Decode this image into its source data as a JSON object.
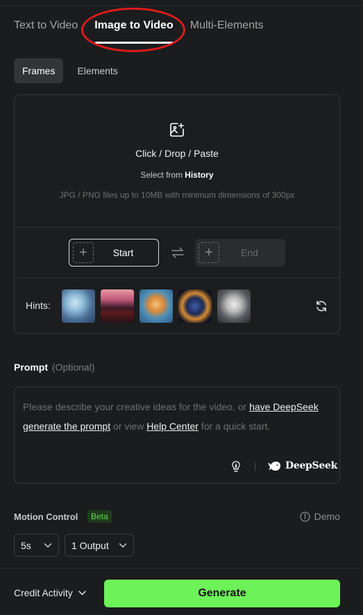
{
  "mode_tabs": [
    {
      "label": "Text to Video",
      "active": false
    },
    {
      "label": "Image to Video",
      "active": true
    },
    {
      "label": "Multi-Elements",
      "active": false
    }
  ],
  "sub_tabs": [
    {
      "label": "Frames",
      "active": true
    },
    {
      "label": "Elements",
      "active": false
    }
  ],
  "upload": {
    "main_label": "Click / Drop / Paste",
    "select_prefix": "Select from",
    "history_link": "History",
    "note": "JPG / PNG files up to 10MB with minimum dimensions of 300px",
    "icon": "image-add-icon"
  },
  "frames": {
    "start_label": "Start",
    "end_label": "End",
    "swap_icon": "swap-arrows-icon"
  },
  "hints": {
    "label": "Hints:",
    "thumbnail_count": 5,
    "refresh_icon": "refresh-icon"
  },
  "prompt": {
    "title": "Prompt",
    "optional": "(Optional)",
    "placeholder_part1": "Please describe your creative ideas for the video, or ",
    "link_deepseek": "have DeepSeek generate the prompt",
    "placeholder_part2": " or view ",
    "link_help": "Help Center",
    "placeholder_part3": " for a quick start.",
    "deepseek_label": "DeepSeek",
    "bulb_icon": "lightbulb-icon"
  },
  "motion": {
    "title": "Motion Control",
    "badge": "Beta",
    "demo_label": "Demo"
  },
  "selects": {
    "duration": "5s",
    "outputs": "1 Output"
  },
  "bottom": {
    "credit_label": "Credit Activity",
    "generate_label": "Generate"
  },
  "colors": {
    "background": "#1b1c1e",
    "accent_green": "#6ef25a",
    "highlight_red": "#e01b1b",
    "beta_green": "#5ed94a"
  }
}
